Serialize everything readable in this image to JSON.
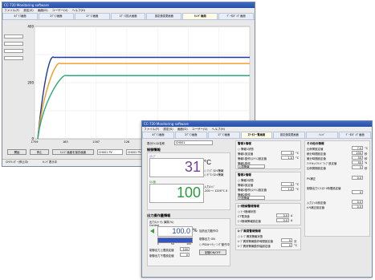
{
  "back_window": {
    "title": "CC-720 Monitoring software",
    "menu": [
      "ファイル(F)",
      "設定(S)",
      "画面(D)",
      "ユーザー(U)",
      "ヘルプ(H)"
    ],
    "tabs": [
      "4ｸﾞﾗﾌ画面",
      "2ｸﾞﾗﾌ画面",
      "1ｸﾞﾗﾌ画面",
      "1ｸﾞﾗﾌ拡大画面",
      "設定値変更画面",
      "ﾄﾚﾝﾄﾞ画面",
      "ﾃﾞｰﾀﾛｷﾞﾝｸﾞ画面"
    ],
    "active_tab_index": 5,
    "y_axis_ticks": [
      "400",
      "200",
      "0"
    ],
    "x_axis_ticks": [
      "1709",
      "163",
      "1167",
      "126",
      "1033",
      "1417",
      "1",
      "2"
    ],
    "buttons": {
      "start": "開始",
      "stop": "停止",
      "snapshot": "ﾄﾚﾝﾄﾞ画面を保存画面"
    },
    "channel_select": "CH001 PV",
    "channel_select_2": "CH002 PV",
    "status": [
      "CH7ﾚﾝﾀﾞｰ(停止中)",
      "ﾄﾚﾝﾄﾞ表示中"
    ],
    "series_colors": [
      "#1f3a9e",
      "#f29b1f",
      "#2aaa78"
    ],
    "series_levels": [
      290,
      268,
      225
    ]
  },
  "front_window": {
    "title": "CC-720 Monitoring software",
    "menu": [
      "ファイル(F)",
      "設定(S)",
      "画面(D)",
      "ユーザー(U)",
      "ヘルプ(H)"
    ],
    "tabs": [
      "4ｸﾞﾗﾌ画面",
      "2ｸﾞﾗﾌ画面",
      "1ｸﾞﾗﾌ画面",
      "ｽﾃｰﾀｽ一覧画面",
      "設定値変更画面",
      "ﾄﾚﾝﾄﾞ",
      "ﾃﾞｰﾀﾛｷﾞﾝｸﾞ画面"
    ],
    "active_tab_index": 3,
    "channel_label": "表示ﾁｬﾝﾈﾙ名称",
    "channel_value": "CH001",
    "control_info": {
      "title": "制御情報",
      "pv_label": "ｽﾃｯﾌﾟ",
      "pv_value": "31",
      "unit": "°C",
      "alarm_options": [
        "ｱｯﾌﾟﾗｽﾄﾙ警報",
        "ﾀﾞｳﾝﾗｽﾄﾙ警報"
      ],
      "sv_label": "SV値",
      "sv_value": "100",
      "input_label": "入力ﾚﾝｼﾞ",
      "input_range": "-200 ～ 1200°C X"
    },
    "output_info": {
      "title": "出力操作量情報",
      "sub": "出力1(ﾍｰﾀ) 演算(%)",
      "control_label": "Control",
      "mv_value": "100.0",
      "mv_unit": "%",
      "heater": "加熱出力動作中",
      "output_state": "制御出力 ON",
      "pid_note": "PID/ｵｰﾄﾁｭｰﾆﾝｸﾞ動作中",
      "scale": [
        "0",
        "50",
        "100"
      ],
      "upper_limit_label": "制御出力上限設定値",
      "upper_limit": "100",
      "lower_limit_label": "制御出力下限設定値",
      "lower_limit": "0",
      "onoff_button": "制御ON/OFF"
    },
    "alarm1": {
      "title": "警報1情報",
      "items": [
        "警報1状態",
        "警報1設定値",
        "警報1動作ﾋｽﾃﾘｼｽ設定値",
        "警報1動作"
      ],
      "checkbox_text": "警報1状態",
      "values": [
        "0",
        "1.0"
      ],
      "unit": "°C",
      "mode": "上限警報"
    },
    "alarm2": {
      "title": "警報2情報",
      "items": [
        "警報2状態",
        "警報2設定値",
        "警報2動作ﾋｽﾃﾘｼｽ設定値",
        "警報2動作"
      ],
      "checkbox_text": "警報2状態",
      "values": [
        "0",
        "1.0"
      ],
      "unit": "°C",
      "mode": "下限警報"
    },
    "heater_alarm": {
      "title": "ﾋｰﾀ断線警報情報",
      "items": [
        "ﾋｰﾀ断線状態",
        "CT電流値",
        "ﾋｰﾀ断線警報設定値"
      ],
      "values": [
        "0.0",
        "0.0"
      ],
      "unit": "A"
    },
    "loop_alarm": {
      "title": "ﾙｰﾌﾟ異常警報情報",
      "items": [
        "ﾙｰﾌﾟ異常警報状態",
        "ﾙｰﾌﾟ異常警報動作時間設定値",
        "ﾙｰﾌﾟ異常警報動作幅設定値"
      ],
      "values": [
        "0",
        "0"
      ],
      "units": [
        "分",
        "°C"
      ]
    },
    "other": {
      "title": "その他の情報",
      "items": [
        "比例帯設定値",
        "積分時間設定値",
        "微分時間設定値",
        "ｱﾝﾁﾘｾｯﾄﾜｲﾝﾄﾞｱｯﾌﾟ設定値",
        "比例周期設定値"
      ],
      "values": [
        "7.0",
        "200",
        "50",
        "50",
        "5"
      ],
      "units": [
        "°C",
        "秒",
        "秒",
        "%",
        "秒"
      ],
      "pv_filter_label": "PV補正",
      "pv_filter_value": "0.0",
      "sensor_label": "制御出力ｿﾌﾄｽﾀｰﾄ時間設定値",
      "sensor_value": "0",
      "input_filter_label": "入力ﾌｨﾙﾀ設定値",
      "input_filter_value": "0.0",
      "sensor_correction_label": "ｾﾝｻ補正設定値",
      "sensor_correction_value": "0.0"
    }
  }
}
